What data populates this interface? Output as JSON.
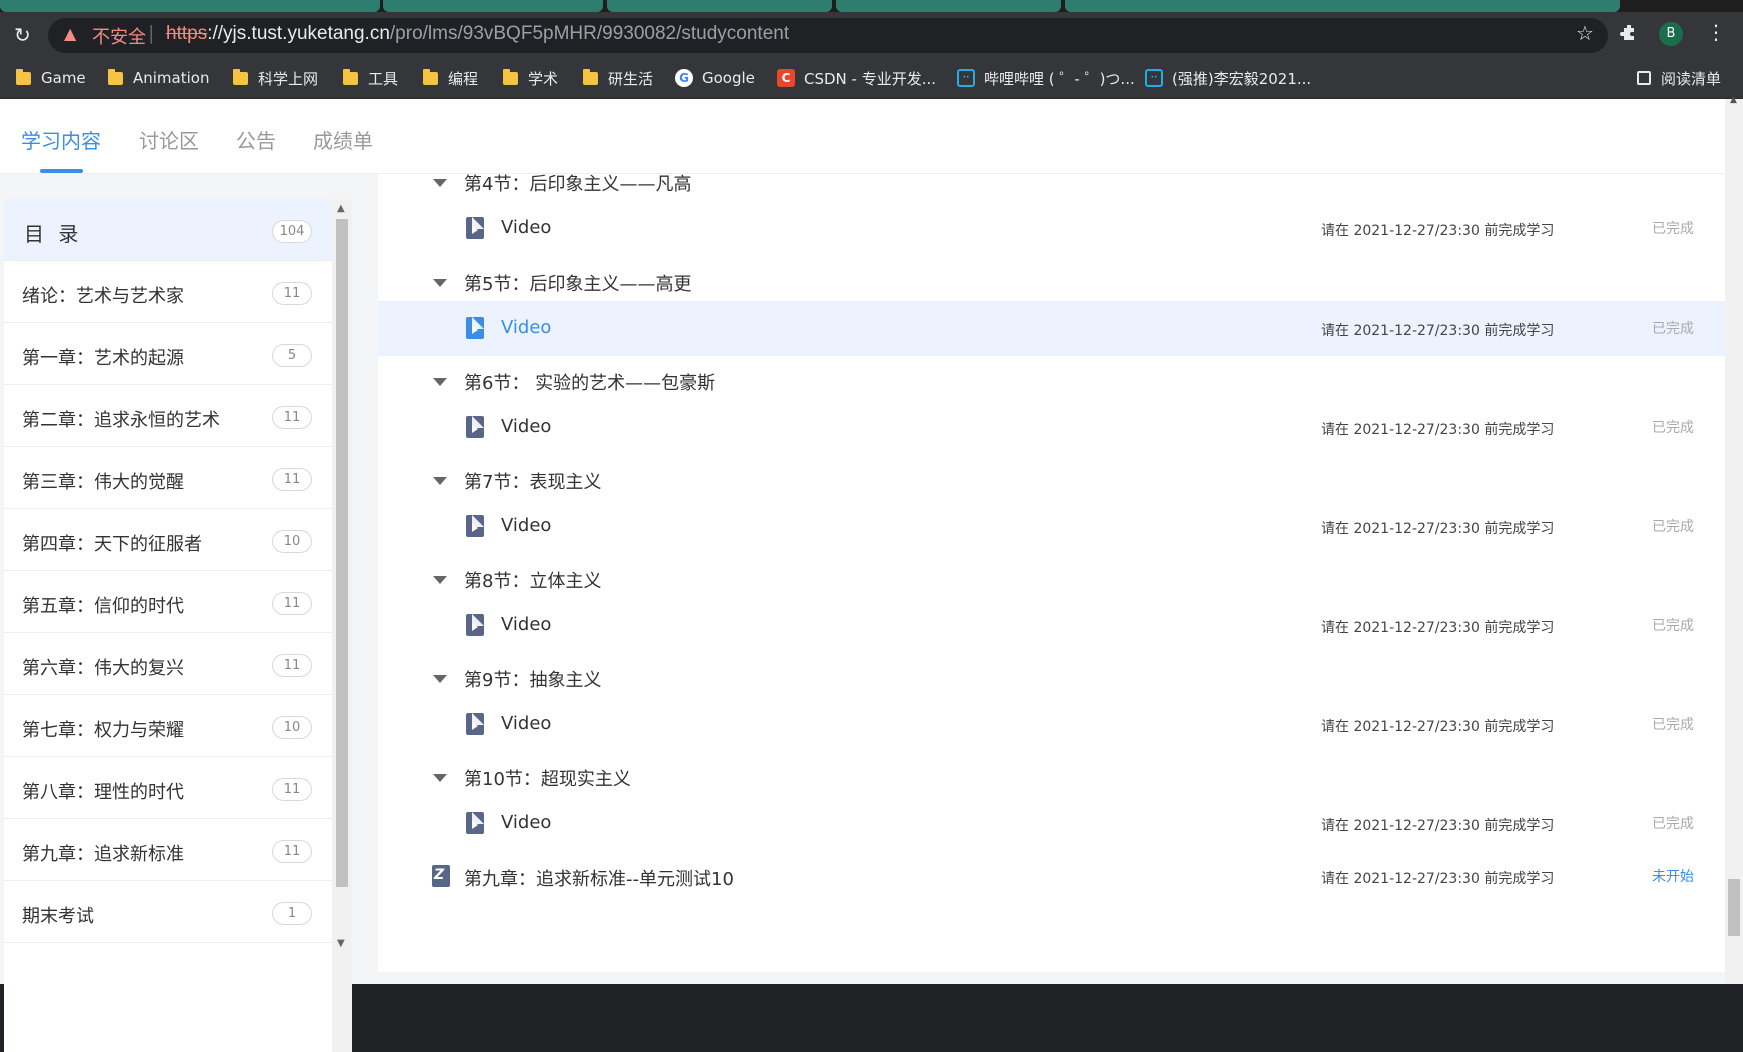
{
  "browser": {
    "security_label": "不安全",
    "url_scheme": "https",
    "url_host": "://yjs.tust.yuketang.cn",
    "url_path": "/pro/lms/93vBQF5pMHR/9930082/studycontent",
    "profile_initial": "B",
    "reading_mode_label": "阅读清单",
    "bookmarks": [
      {
        "label": "Game",
        "type": "folder"
      },
      {
        "label": "Animation",
        "type": "folder"
      },
      {
        "label": "科学上网",
        "type": "folder"
      },
      {
        "label": "工具",
        "type": "folder"
      },
      {
        "label": "编程",
        "type": "folder"
      },
      {
        "label": "学术",
        "type": "folder"
      },
      {
        "label": "研生活",
        "type": "folder"
      },
      {
        "label": "Google",
        "type": "site"
      },
      {
        "label": "CSDN - 专业开发...",
        "type": "site"
      },
      {
        "label": "哔哩哔哩 ( ゜- ゜)つ...",
        "type": "site"
      },
      {
        "label": "(强推)李宏毅2021...",
        "type": "site"
      }
    ]
  },
  "nav": {
    "tabs": [
      "学习内容",
      "讨论区",
      "公告",
      "成绩单"
    ],
    "active_tab": "学习内容"
  },
  "sidebar": {
    "header": {
      "label": "目 录",
      "count": "104"
    },
    "items": [
      {
        "label": "绪论：艺术与艺术家",
        "count": "11"
      },
      {
        "label": "第一章：艺术的起源",
        "count": "5"
      },
      {
        "label": "第二章：追求永恒的艺术",
        "count": "11"
      },
      {
        "label": "第三章：伟大的觉醒",
        "count": "11"
      },
      {
        "label": "第四章：天下的征服者",
        "count": "10"
      },
      {
        "label": "第五章：信仰的时代",
        "count": "11"
      },
      {
        "label": "第六章：伟大的复兴",
        "count": "11"
      },
      {
        "label": "第七章：权力与荣耀",
        "count": "10"
      },
      {
        "label": "第八章：理性的时代",
        "count": "11"
      },
      {
        "label": "第九章：追求新标准",
        "count": "11"
      },
      {
        "label": "期末考试",
        "count": "1"
      }
    ]
  },
  "content": {
    "partial_section_title": "第4节：后印象主义——凡高",
    "sections": [
      {
        "title": "第5节：后印象主义——高更"
      },
      {
        "title": "第6节： 实验的艺术——包豪斯"
      },
      {
        "title": "第7节：表现主义"
      },
      {
        "title": "第8节：立体主义"
      },
      {
        "title": "第9节：抽象主义"
      },
      {
        "title": "第10节：超现实主义"
      }
    ],
    "video_label": "Video",
    "deadline_text": "请在 2021-12-27/23:30 前完成学习",
    "status_done": "已完成",
    "quiz": {
      "title": "第九章：追求新标准--单元测试10",
      "deadline": "请在 2021-12-27/23:30 前完成学习",
      "status": "未开始"
    }
  }
}
